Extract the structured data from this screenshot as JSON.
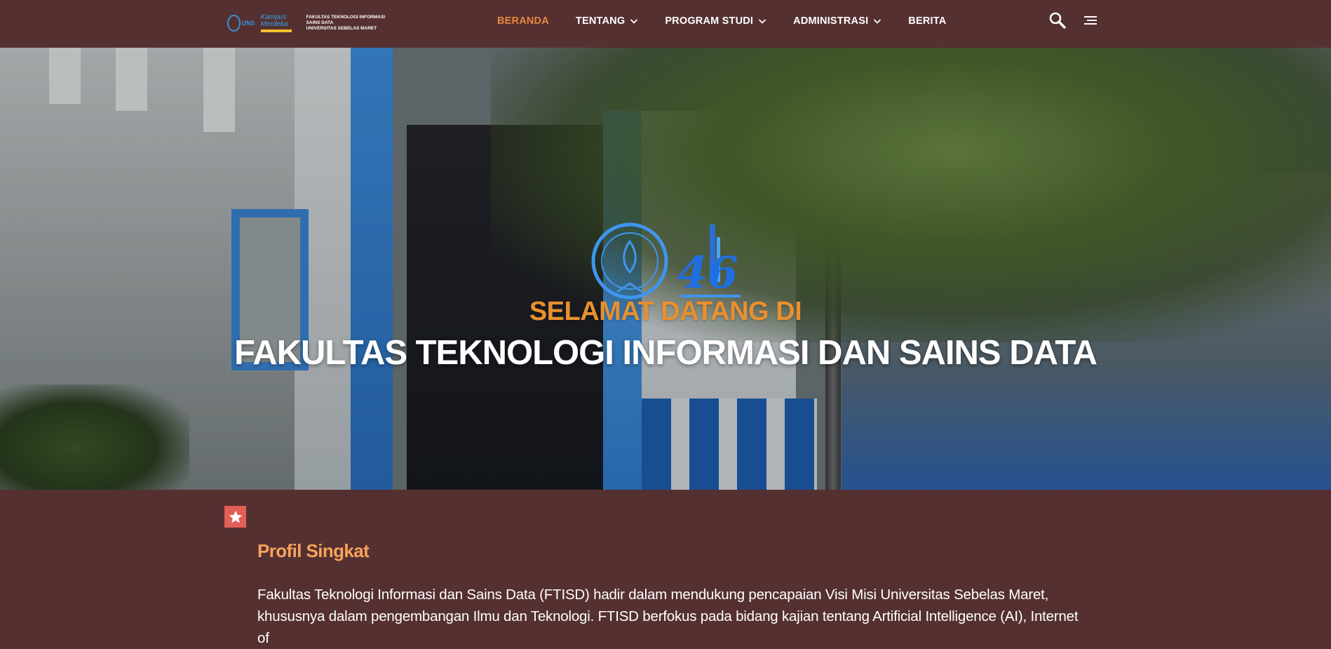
{
  "header": {
    "logo": {
      "uns_text": "UNS",
      "kampus_text": "Kampus Merdeka",
      "lines": [
        "FAKULTAS TEKNOLOGI INFORMASI",
        "SAINS DATA",
        "UNIVERSITAS SEBELAS MARET"
      ]
    },
    "nav": [
      {
        "label": "BERANDA",
        "active": true,
        "has_dropdown": false
      },
      {
        "label": "TENTANG",
        "active": false,
        "has_dropdown": true
      },
      {
        "label": "PROGRAM STUDI",
        "active": false,
        "has_dropdown": true
      },
      {
        "label": "ADMINISTRASI",
        "active": false,
        "has_dropdown": true
      },
      {
        "label": "BERITA",
        "active": false,
        "has_dropdown": false
      }
    ],
    "icons": {
      "search": "search-icon",
      "menu": "menu-icon"
    }
  },
  "hero": {
    "subtitle": "SELAMAT DATANG DI",
    "title": "FAKULTAS TEKNOLOGI INFORMASI DAN SAINS DATA",
    "anniversary_number": "46"
  },
  "profile": {
    "icon": "star-icon",
    "title": "Profil Singkat",
    "body": "Fakultas Teknologi Informasi dan Sains Data (FTISD) hadir dalam mendukung pencapaian Visi Misi Universitas Sebelas Maret, khususnya dalam pengembangan Ilmu dan Teknologi. FTISD berfokus pada bidang kajian tentang Artificial Intelligence (AI), Internet of"
  },
  "colors": {
    "background": "#553031",
    "accent_orange": "#e8843f",
    "heading_orange": "#f6a35a",
    "star_badge": "#e25f58"
  }
}
